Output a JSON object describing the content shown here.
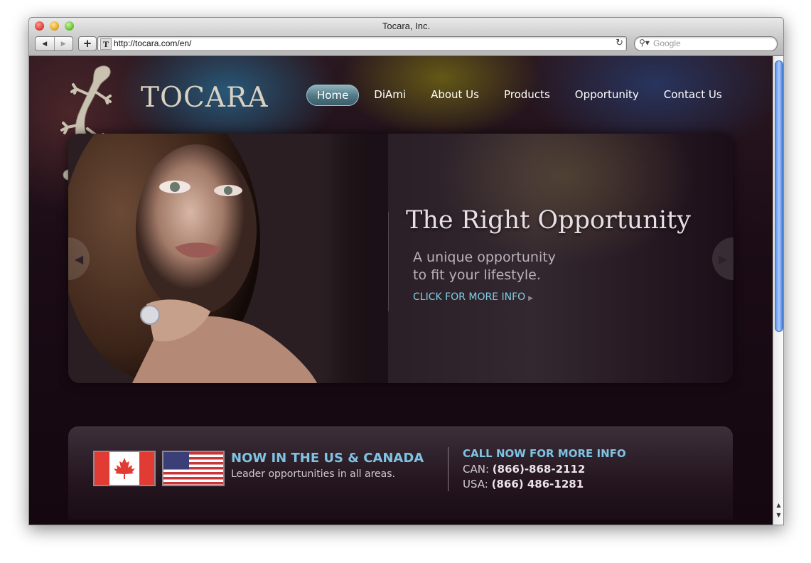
{
  "window": {
    "title": "Tocara, Inc."
  },
  "toolbar": {
    "back_icon": "back-arrow-icon",
    "forward_icon": "forward-arrow-icon",
    "add_label": "+",
    "url": "http://tocara.com/en/",
    "search_placeholder": "Google"
  },
  "site": {
    "logo_text": "TOCARA",
    "nav": [
      {
        "label": "Home",
        "active": true
      },
      {
        "label": "DiAmi"
      },
      {
        "label": "About Us"
      },
      {
        "label": "Products"
      },
      {
        "label": "Opportunity"
      },
      {
        "label": "Contact Us"
      }
    ],
    "hero": {
      "title": "The Right Opportunity",
      "subtitle_line1": "A unique opportunity",
      "subtitle_line2": "to fit your lifestyle.",
      "link": "CLICK FOR MORE INFO"
    },
    "info": {
      "headline": "NOW IN THE US & CANADA",
      "subline": "Leader opportunities in all areas.",
      "call_heading": "CALL NOW FOR MORE INFO",
      "can_label": "CAN:",
      "can_phone": "(866)-868-2112",
      "usa_label": "USA:",
      "usa_phone": "(866) 486-1281"
    }
  },
  "colors": {
    "accent": "#7fc3e2",
    "nav_active": "#4f7784",
    "page_bg": "#1b0c16"
  }
}
